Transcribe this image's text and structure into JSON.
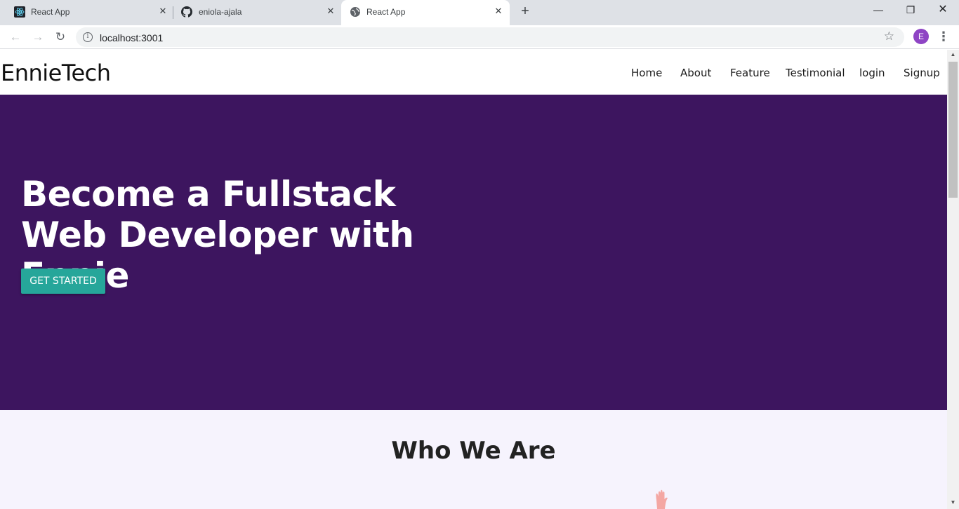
{
  "browser": {
    "tabs": [
      {
        "title": "React App",
        "icon": "react-logo-icon",
        "active": false
      },
      {
        "title": "eniola-ajala",
        "icon": "github-icon",
        "active": false
      },
      {
        "title": "React App",
        "icon": "globe-icon",
        "active": true
      }
    ],
    "new_tab_glyph": "+",
    "window_controls": {
      "minimize": "—",
      "maximize": "❐",
      "close": "✕"
    },
    "close_glyph": "✕",
    "nav": {
      "back": "←",
      "forward": "→",
      "reload": "↻"
    },
    "address": {
      "info_glyph": "i",
      "url": "localhost:3001"
    },
    "bookmark_glyph": "☆",
    "profile_initial": "E",
    "menu_glyph": "⋮"
  },
  "site": {
    "brand": "EnnieTech",
    "nav_links": [
      "Home",
      "About",
      "Feature",
      "Testimonial",
      "login",
      "Signup"
    ],
    "hero": {
      "title": "Become a Fullstack Web Developer with Ennie",
      "cta_label": "GET STARTED"
    },
    "who_we_are": {
      "title": "Who We Are"
    }
  },
  "colors": {
    "hero_bg": "#3d155f",
    "cta_bg": "#26a69a",
    "section_bg": "#f6f3fd",
    "profile_bg": "#8e44c4",
    "tabstrip_bg": "#dee1e6"
  }
}
